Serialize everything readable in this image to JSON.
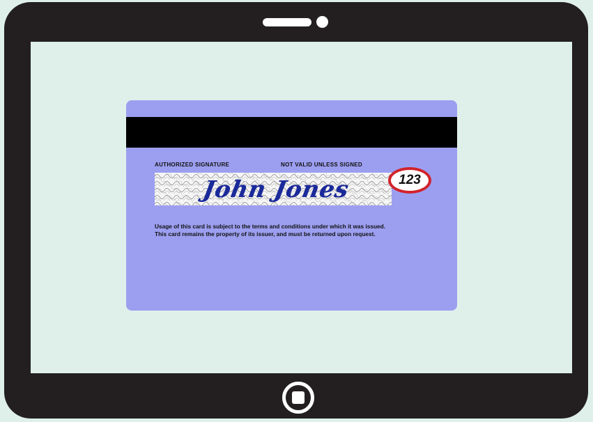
{
  "card": {
    "signature_label": "AUTHORIZED SIGNATURE",
    "validity_label": "NOT VALID UNLESS SIGNED",
    "signature": "John Jones",
    "security_code": "123",
    "terms_line1": "Usage of this card is subject to the terms and conditions under which it was issued.",
    "terms_line2": "This card remains the property of its issuer, and must be returned upon request."
  },
  "colors": {
    "card_background": "#9c9ff0",
    "magnetic_stripe": "#000000",
    "security_code_ring": "#d1232a",
    "signature_ink": "#1b2a9a",
    "tablet_frame": "#231f20",
    "screen": "#dff0eb"
  },
  "icons": [
    "speaker-icon",
    "camera-icon",
    "home-button-icon"
  ]
}
